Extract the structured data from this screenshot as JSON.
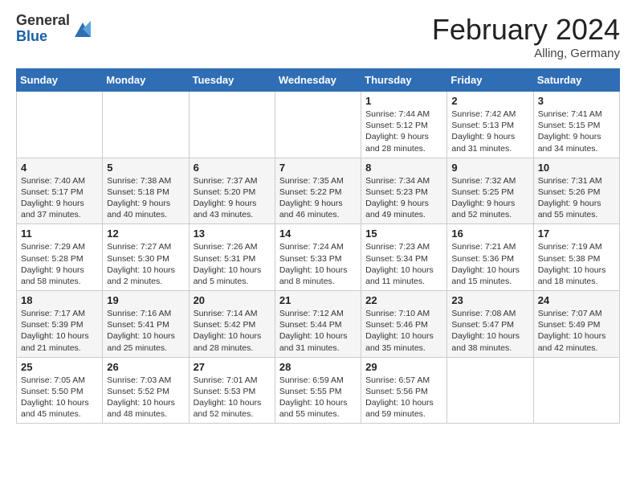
{
  "logo": {
    "general": "General",
    "blue": "Blue"
  },
  "title": "February 2024",
  "location": "Alling, Germany",
  "weekdays": [
    "Sunday",
    "Monday",
    "Tuesday",
    "Wednesday",
    "Thursday",
    "Friday",
    "Saturday"
  ],
  "weeks": [
    [
      {
        "day": "",
        "info": ""
      },
      {
        "day": "",
        "info": ""
      },
      {
        "day": "",
        "info": ""
      },
      {
        "day": "",
        "info": ""
      },
      {
        "day": "1",
        "info": "Sunrise: 7:44 AM\nSunset: 5:12 PM\nDaylight: 9 hours\nand 28 minutes."
      },
      {
        "day": "2",
        "info": "Sunrise: 7:42 AM\nSunset: 5:13 PM\nDaylight: 9 hours\nand 31 minutes."
      },
      {
        "day": "3",
        "info": "Sunrise: 7:41 AM\nSunset: 5:15 PM\nDaylight: 9 hours\nand 34 minutes."
      }
    ],
    [
      {
        "day": "4",
        "info": "Sunrise: 7:40 AM\nSunset: 5:17 PM\nDaylight: 9 hours\nand 37 minutes."
      },
      {
        "day": "5",
        "info": "Sunrise: 7:38 AM\nSunset: 5:18 PM\nDaylight: 9 hours\nand 40 minutes."
      },
      {
        "day": "6",
        "info": "Sunrise: 7:37 AM\nSunset: 5:20 PM\nDaylight: 9 hours\nand 43 minutes."
      },
      {
        "day": "7",
        "info": "Sunrise: 7:35 AM\nSunset: 5:22 PM\nDaylight: 9 hours\nand 46 minutes."
      },
      {
        "day": "8",
        "info": "Sunrise: 7:34 AM\nSunset: 5:23 PM\nDaylight: 9 hours\nand 49 minutes."
      },
      {
        "day": "9",
        "info": "Sunrise: 7:32 AM\nSunset: 5:25 PM\nDaylight: 9 hours\nand 52 minutes."
      },
      {
        "day": "10",
        "info": "Sunrise: 7:31 AM\nSunset: 5:26 PM\nDaylight: 9 hours\nand 55 minutes."
      }
    ],
    [
      {
        "day": "11",
        "info": "Sunrise: 7:29 AM\nSunset: 5:28 PM\nDaylight: 9 hours\nand 58 minutes."
      },
      {
        "day": "12",
        "info": "Sunrise: 7:27 AM\nSunset: 5:30 PM\nDaylight: 10 hours\nand 2 minutes."
      },
      {
        "day": "13",
        "info": "Sunrise: 7:26 AM\nSunset: 5:31 PM\nDaylight: 10 hours\nand 5 minutes."
      },
      {
        "day": "14",
        "info": "Sunrise: 7:24 AM\nSunset: 5:33 PM\nDaylight: 10 hours\nand 8 minutes."
      },
      {
        "day": "15",
        "info": "Sunrise: 7:23 AM\nSunset: 5:34 PM\nDaylight: 10 hours\nand 11 minutes."
      },
      {
        "day": "16",
        "info": "Sunrise: 7:21 AM\nSunset: 5:36 PM\nDaylight: 10 hours\nand 15 minutes."
      },
      {
        "day": "17",
        "info": "Sunrise: 7:19 AM\nSunset: 5:38 PM\nDaylight: 10 hours\nand 18 minutes."
      }
    ],
    [
      {
        "day": "18",
        "info": "Sunrise: 7:17 AM\nSunset: 5:39 PM\nDaylight: 10 hours\nand 21 minutes."
      },
      {
        "day": "19",
        "info": "Sunrise: 7:16 AM\nSunset: 5:41 PM\nDaylight: 10 hours\nand 25 minutes."
      },
      {
        "day": "20",
        "info": "Sunrise: 7:14 AM\nSunset: 5:42 PM\nDaylight: 10 hours\nand 28 minutes."
      },
      {
        "day": "21",
        "info": "Sunrise: 7:12 AM\nSunset: 5:44 PM\nDaylight: 10 hours\nand 31 minutes."
      },
      {
        "day": "22",
        "info": "Sunrise: 7:10 AM\nSunset: 5:46 PM\nDaylight: 10 hours\nand 35 minutes."
      },
      {
        "day": "23",
        "info": "Sunrise: 7:08 AM\nSunset: 5:47 PM\nDaylight: 10 hours\nand 38 minutes."
      },
      {
        "day": "24",
        "info": "Sunrise: 7:07 AM\nSunset: 5:49 PM\nDaylight: 10 hours\nand 42 minutes."
      }
    ],
    [
      {
        "day": "25",
        "info": "Sunrise: 7:05 AM\nSunset: 5:50 PM\nDaylight: 10 hours\nand 45 minutes."
      },
      {
        "day": "26",
        "info": "Sunrise: 7:03 AM\nSunset: 5:52 PM\nDaylight: 10 hours\nand 48 minutes."
      },
      {
        "day": "27",
        "info": "Sunrise: 7:01 AM\nSunset: 5:53 PM\nDaylight: 10 hours\nand 52 minutes."
      },
      {
        "day": "28",
        "info": "Sunrise: 6:59 AM\nSunset: 5:55 PM\nDaylight: 10 hours\nand 55 minutes."
      },
      {
        "day": "29",
        "info": "Sunrise: 6:57 AM\nSunset: 5:56 PM\nDaylight: 10 hours\nand 59 minutes."
      },
      {
        "day": "",
        "info": ""
      },
      {
        "day": "",
        "info": ""
      }
    ]
  ]
}
